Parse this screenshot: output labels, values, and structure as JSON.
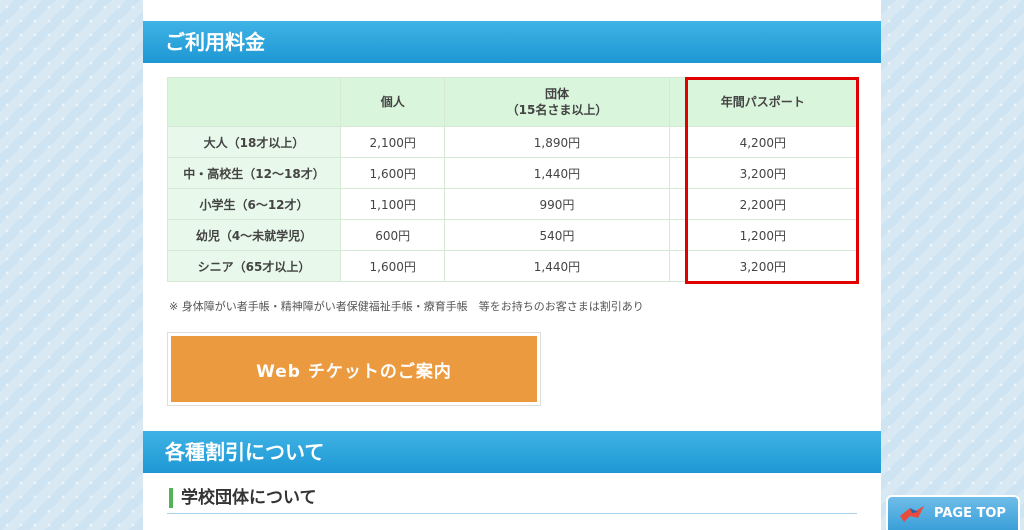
{
  "sections": {
    "pricing_title": "ご利用料金",
    "discount_title": "各種割引について"
  },
  "table": {
    "headers": [
      "",
      "個人",
      "団体\n（15名さま以上）",
      "年間パスポート"
    ],
    "header_group_line1": "団体",
    "header_group_line2": "（15名さま以上）",
    "rows": [
      {
        "label": "大人（18才以上）",
        "individual": "2,100円",
        "group": "1,890円",
        "annual": "4,200円"
      },
      {
        "label": "中・高校生（12〜18才）",
        "individual": "1,600円",
        "group": "1,440円",
        "annual": "3,200円"
      },
      {
        "label": "小学生（6〜12才）",
        "individual": "1,100円",
        "group": "990円",
        "annual": "2,200円"
      },
      {
        "label": "幼児（4〜未就学児）",
        "individual": "600円",
        "group": "540円",
        "annual": "1,200円"
      },
      {
        "label": "シニア（65才以上）",
        "individual": "1,600円",
        "group": "1,440円",
        "annual": "3,200円"
      }
    ]
  },
  "note": "※ 身体障がい者手帳・精神障がい者保健福祉手帳・療育手帳　等をお持ちのお客さまは割引あり",
  "web_ticket_label": "Web チケットのご案内",
  "sub_heading": "学校団体について",
  "page_top_label": "PAGE TOP",
  "colors": {
    "header_blue": "#1e97d3",
    "highlight_red": "#e00000",
    "ticket_orange": "#ec9a3f",
    "table_header_green": "#d9f5dc"
  }
}
